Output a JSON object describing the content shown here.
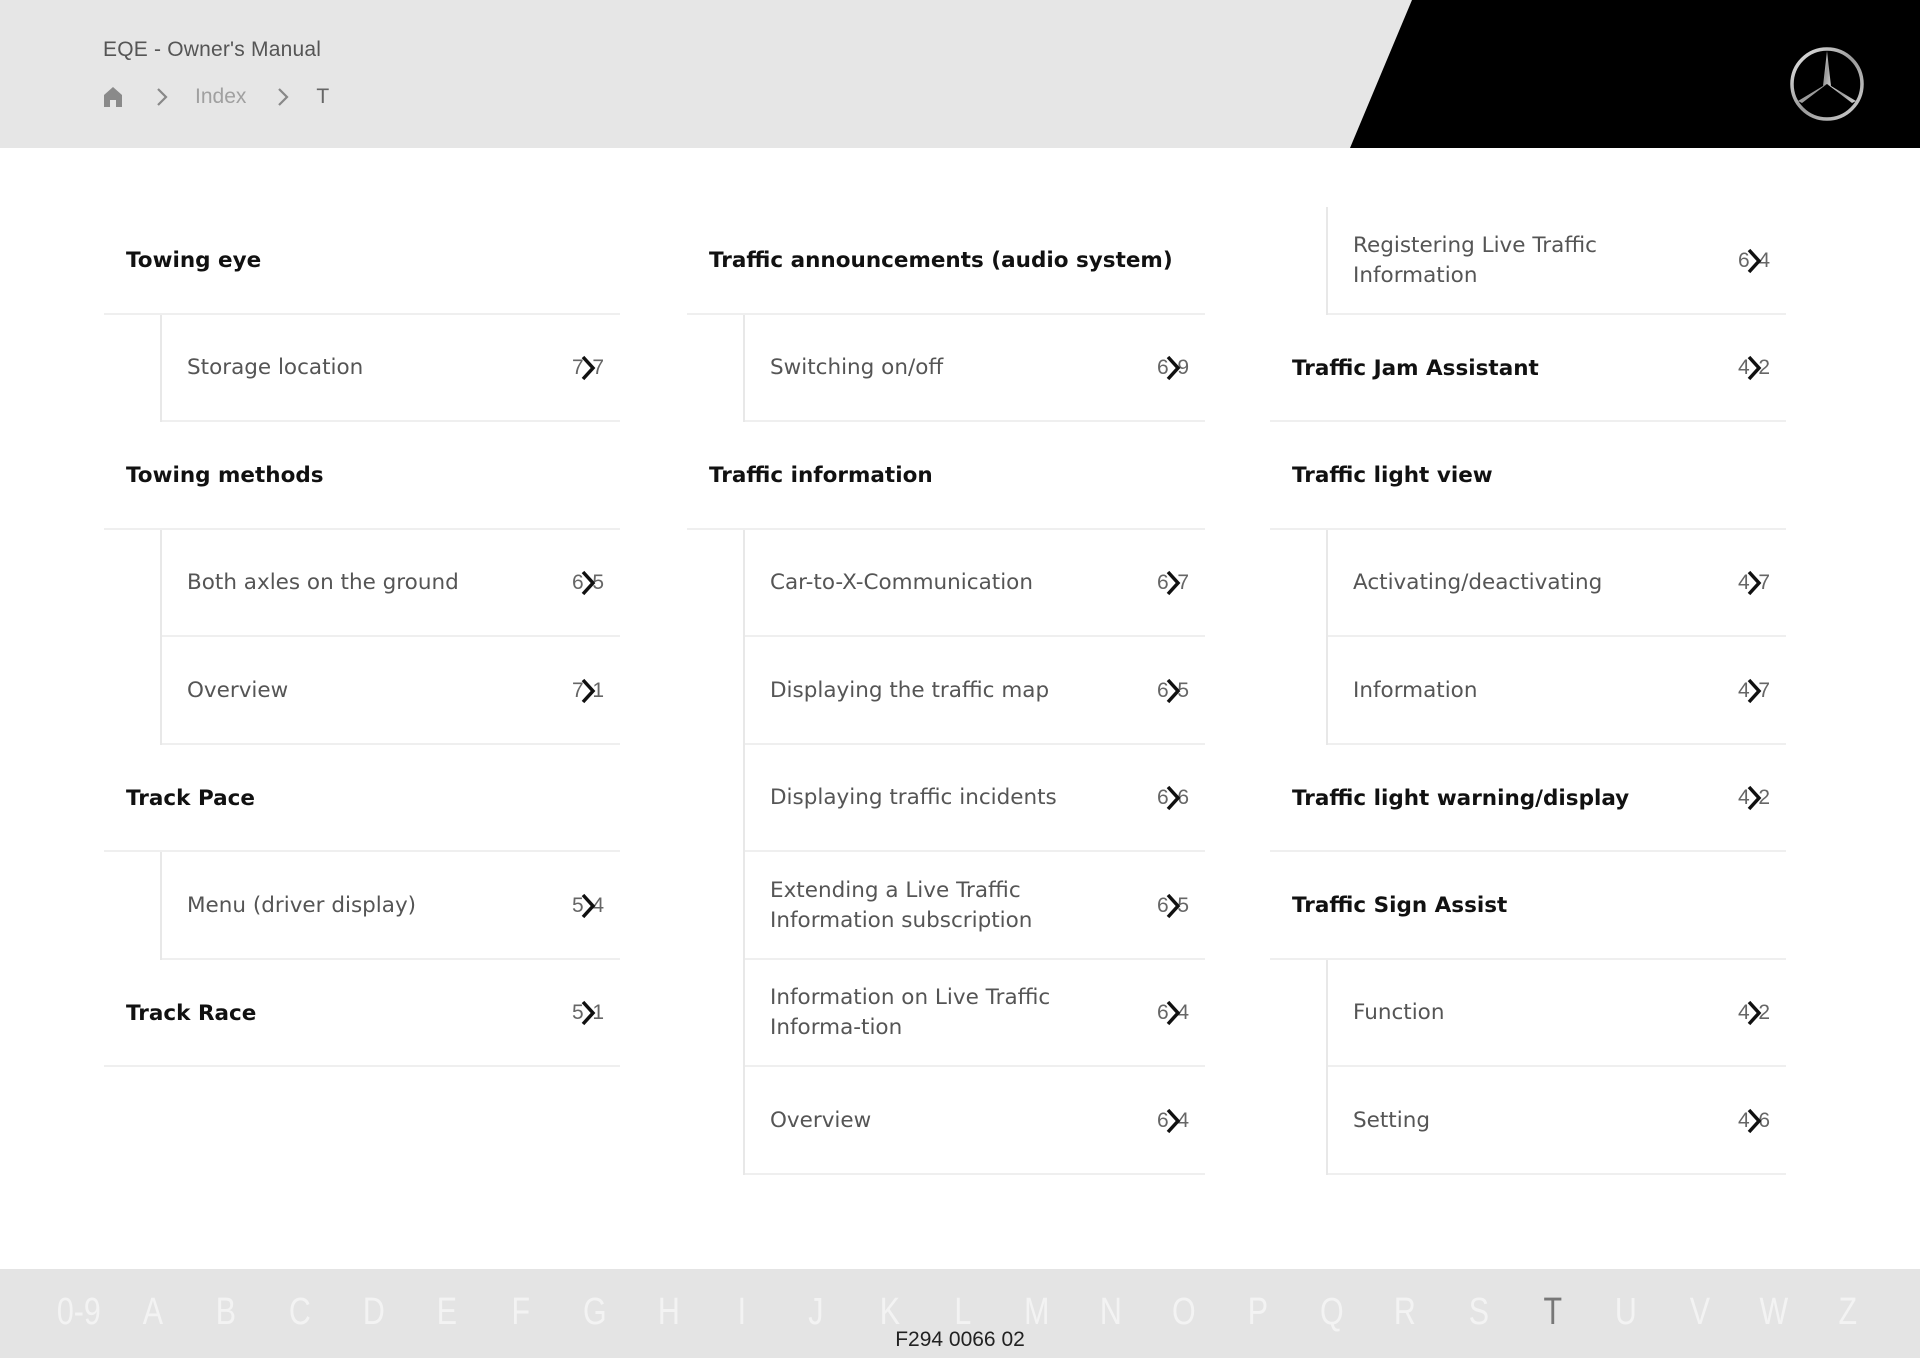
{
  "header": {
    "title": "EQE - Owner's Manual",
    "breadcrumb": {
      "home_icon": "home-icon",
      "separator_icon": "chevron-right-icon",
      "items": [
        "Index",
        "T"
      ]
    },
    "logo": "mercedes-star-logo",
    "colors": {
      "header_bg": "#e6e6e6",
      "brand_block": "#000000"
    }
  },
  "columns": [
    {
      "entries": [
        {
          "type": "heading",
          "label": "Towing eye"
        },
        {
          "type": "sub",
          "label": "Storage location",
          "page_visible": [
            "7",
            "7"
          ]
        },
        {
          "type": "heading",
          "label": "Towing methods"
        },
        {
          "type": "sub",
          "label": "Both axles on the ground",
          "page_visible": [
            "6",
            "5"
          ]
        },
        {
          "type": "sub",
          "label": "Overview",
          "page_visible": [
            "7",
            "1"
          ]
        },
        {
          "type": "heading",
          "label": "Track Pace"
        },
        {
          "type": "sub",
          "label": "Menu (driver display)",
          "page_visible": [
            "5",
            "4"
          ]
        },
        {
          "type": "heading-link",
          "label": "Track Race",
          "page_visible": [
            "5",
            "1"
          ]
        }
      ]
    },
    {
      "entries": [
        {
          "type": "heading",
          "label": "Traffic announcements (audio system)"
        },
        {
          "type": "sub",
          "label": "Switching on/off",
          "page_visible": [
            "6",
            "9"
          ]
        },
        {
          "type": "heading",
          "label": "Traffic information"
        },
        {
          "type": "sub",
          "label": "Car-to-X-Communication",
          "page_visible": [
            "6",
            "7"
          ]
        },
        {
          "type": "sub",
          "label": "Displaying the traffic map",
          "page_visible": [
            "6",
            "5"
          ]
        },
        {
          "type": "sub",
          "label": "Displaying traffic incidents",
          "page_visible": [
            "6",
            "6"
          ]
        },
        {
          "type": "sub",
          "label": "Extending a Live Traffic Information subscription",
          "page_visible": [
            "6",
            "5"
          ]
        },
        {
          "type": "sub",
          "label": "Information on Live Traffic Informa-tion",
          "page_visible": [
            "6",
            "4"
          ]
        },
        {
          "type": "sub",
          "label": "Overview",
          "page_visible": [
            "6",
            "4"
          ]
        }
      ]
    },
    {
      "entries": [
        {
          "type": "sub",
          "label": "Registering Live Traffic Information",
          "page_visible": [
            "6",
            "4"
          ]
        },
        {
          "type": "heading-link",
          "label": "Traffic Jam Assistant",
          "page_visible": [
            "4",
            "2"
          ]
        },
        {
          "type": "heading",
          "label": "Traffic light view"
        },
        {
          "type": "sub",
          "label": "Activating/deactivating",
          "page_visible": [
            "4",
            "7"
          ]
        },
        {
          "type": "sub",
          "label": "Information",
          "page_visible": [
            "4",
            "7"
          ]
        },
        {
          "type": "heading-link",
          "label": "Traffic light warning/display",
          "page_visible": [
            "4",
            "2"
          ]
        },
        {
          "type": "heading",
          "label": "Traffic Sign Assist"
        },
        {
          "type": "sub",
          "label": "Function",
          "page_visible": [
            "4",
            "2"
          ]
        },
        {
          "type": "sub",
          "label": "Setting",
          "page_visible": [
            "4",
            "6"
          ]
        }
      ]
    }
  ],
  "footer": {
    "alphabet": [
      "0-9",
      "A",
      "B",
      "C",
      "D",
      "E",
      "F",
      "G",
      "H",
      "I",
      "J",
      "K",
      "L",
      "M",
      "N",
      "O",
      "P",
      "Q",
      "R",
      "S",
      "T",
      "U",
      "V",
      "W",
      "Z"
    ],
    "active_letter": "T",
    "code": "F294 0066 02"
  }
}
